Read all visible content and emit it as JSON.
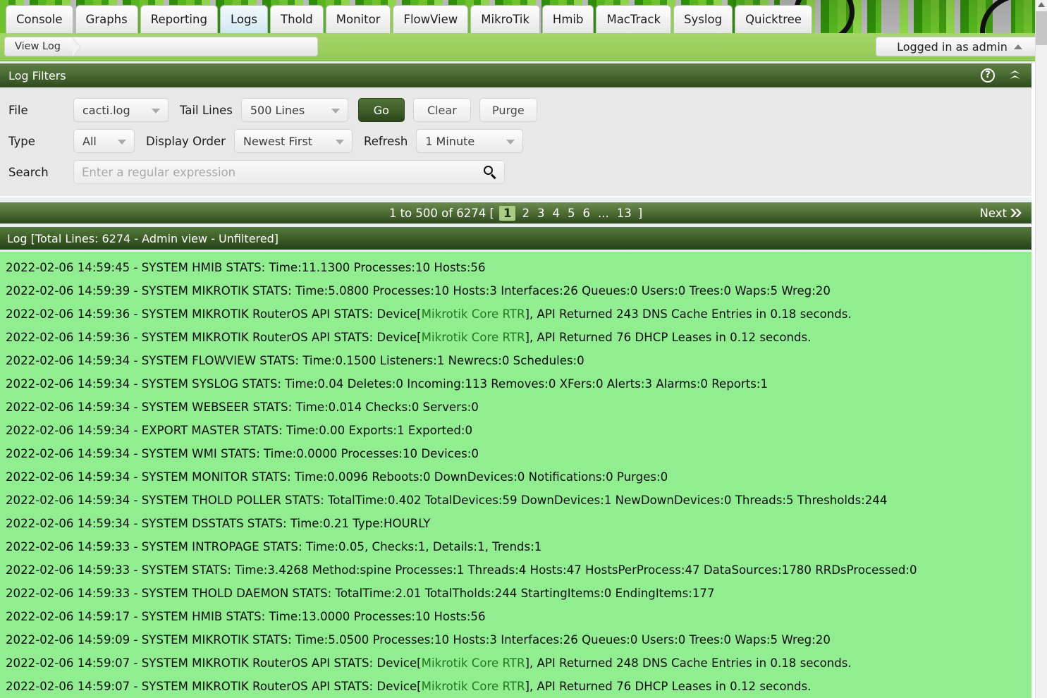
{
  "nav": {
    "tabs": [
      {
        "label": "Console",
        "active": false
      },
      {
        "label": "Graphs",
        "active": false
      },
      {
        "label": "Reporting",
        "active": false
      },
      {
        "label": "Logs",
        "active": true
      },
      {
        "label": "Thold",
        "active": false
      },
      {
        "label": "Monitor",
        "active": false
      },
      {
        "label": "FlowView",
        "active": false
      },
      {
        "label": "MikroTik",
        "active": false
      },
      {
        "label": "Hmib",
        "active": false
      },
      {
        "label": "MacTrack",
        "active": false
      },
      {
        "label": "Syslog",
        "active": false
      },
      {
        "label": "Quicktree",
        "active": false
      }
    ]
  },
  "breadcrumb": {
    "current": "View Log"
  },
  "session": {
    "login_label": "Logged in as admin"
  },
  "filters": {
    "panel_title": "Log Filters",
    "help_icon": "question-circle-icon",
    "collapse_icon": "double-chevron-up-icon",
    "file_label": "File",
    "file_value": "cacti.log",
    "tail_label": "Tail Lines",
    "tail_value": "500 Lines",
    "go_label": "Go",
    "clear_label": "Clear",
    "purge_label": "Purge",
    "type_label": "Type",
    "type_value": "All",
    "order_label": "Display Order",
    "order_value": "Newest First",
    "refresh_label": "Refresh",
    "refresh_value": "1 Minute",
    "search_label": "Search",
    "search_value": "",
    "search_placeholder": "Enter a regular expression",
    "search_icon": "magnifier-icon"
  },
  "pager": {
    "summary": "1 to 500 of 6274 [",
    "pages": [
      "1",
      "2",
      "3",
      "4",
      "5",
      "6",
      "...",
      "13"
    ],
    "current_page": "1",
    "close_bracket": "]",
    "next_label": "Next",
    "next_icon": "double-chevron-right-icon"
  },
  "log": {
    "header": "Log [Total Lines: 6274 - Admin view - Unfiltered]",
    "lines": [
      {
        "text": "2022-02-06 14:59:45 - SYSTEM HMIB STATS: Time:11.1300 Processes:10 Hosts:56"
      },
      {
        "text": "2022-02-06 14:59:39 - SYSTEM MIKROTIK STATS: Time:5.0800 Processes:10 Hosts:3 Interfaces:26 Queues:0 Users:0 Trees:0 Waps:5 Wreg:20"
      },
      {
        "pre": "2022-02-06 14:59:36 - SYSTEM MIKROTIK RouterOS API STATS: Device[",
        "device": "Mikrotik Core RTR",
        "post": "], API Returned 243 DNS Cache Entries in 0.18 seconds."
      },
      {
        "pre": "2022-02-06 14:59:36 - SYSTEM MIKROTIK RouterOS API STATS: Device[",
        "device": "Mikrotik Core RTR",
        "post": "], API Returned 76 DHCP Leases in 0.12 seconds."
      },
      {
        "text": "2022-02-06 14:59:34 - SYSTEM FLOWVIEW STATS: Time:0.1500 Listeners:1 Newrecs:0 Schedules:0"
      },
      {
        "text": "2022-02-06 14:59:34 - SYSTEM SYSLOG STATS: Time:0.04 Deletes:0 Incoming:113 Removes:0 XFers:0 Alerts:3 Alarms:0 Reports:1"
      },
      {
        "text": "2022-02-06 14:59:34 - SYSTEM WEBSEER STATS: Time:0.014 Checks:0 Servers:0"
      },
      {
        "text": "2022-02-06 14:59:34 - EXPORT MASTER STATS: Time:0.00 Exports:1 Exported:0"
      },
      {
        "text": "2022-02-06 14:59:34 - SYSTEM WMI STATS: Time:0.0000 Processes:10 Devices:0"
      },
      {
        "text": "2022-02-06 14:59:34 - SYSTEM MONITOR STATS: Time:0.0096 Reboots:0 DownDevices:0 Notifications:0 Purges:0"
      },
      {
        "text": "2022-02-06 14:59:34 - SYSTEM THOLD POLLER STATS: TotalTime:0.402 TotalDevices:59 DownDevices:1 NewDownDevices:0 Threads:5 Thresholds:244"
      },
      {
        "text": "2022-02-06 14:59:34 - SYSTEM DSSTATS STATS: Time:0.21 Type:HOURLY"
      },
      {
        "text": "2022-02-06 14:59:33 - SYSTEM INTROPAGE STATS: Time:0.05, Checks:1, Details:1, Trends:1"
      },
      {
        "text": "2022-02-06 14:59:33 - SYSTEM STATS: Time:3.4268 Method:spine Processes:1 Threads:4 Hosts:47 HostsPerProcess:47 DataSources:1780 RRDsProcessed:0"
      },
      {
        "text": "2022-02-06 14:59:33 - SYSTEM THOLD DAEMON STATS: TotalTime:2.01 TotalTholds:244 StartingItems:0 EndingItems:177"
      },
      {
        "text": "2022-02-06 14:59:17 - SYSTEM HMIB STATS: Time:13.0000 Processes:10 Hosts:56"
      },
      {
        "text": "2022-02-06 14:59:09 - SYSTEM MIKROTIK STATS: Time:5.0500 Processes:10 Hosts:3 Interfaces:26 Queues:0 Users:0 Trees:0 Waps:5 Wreg:20"
      },
      {
        "pre": "2022-02-06 14:59:07 - SYSTEM MIKROTIK RouterOS API STATS: Device[",
        "device": "Mikrotik Core RTR",
        "post": "], API Returned 248 DNS Cache Entries in 0.18 seconds."
      },
      {
        "pre": "2022-02-06 14:59:07 - SYSTEM MIKROTIK RouterOS API STATS: Device[",
        "device": "Mikrotik Core RTR",
        "post": "], API Returned 76 DHCP Leases in 0.12 seconds."
      }
    ]
  },
  "colors": {
    "log_background": "#90ee90",
    "device_link": "#227722",
    "panel_header": "#2f4a1d",
    "accent_green": "#3d5c28",
    "breadcrumb_strip": "#9ccf5e"
  }
}
